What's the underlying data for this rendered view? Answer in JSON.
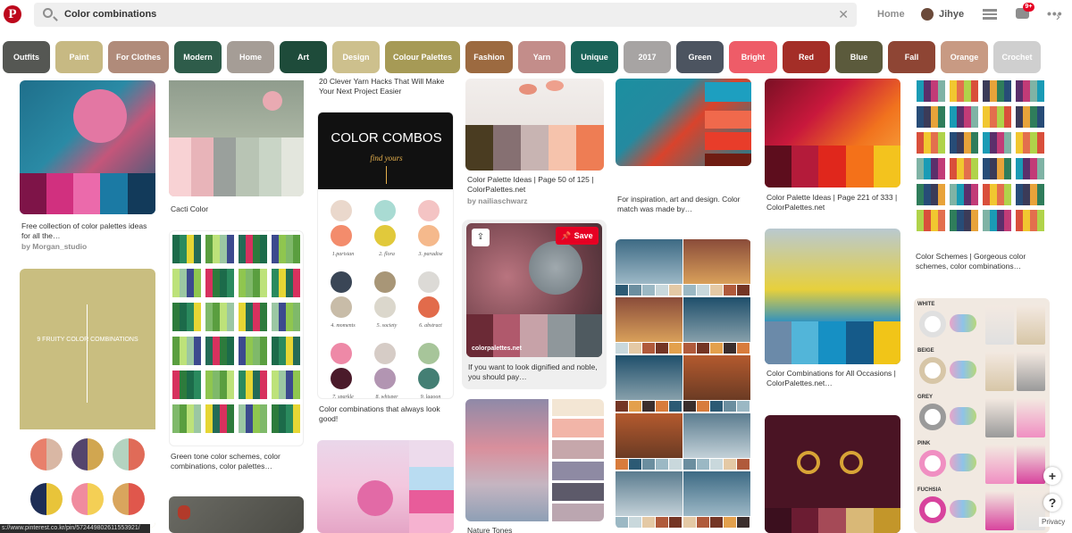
{
  "app": {
    "logo": "P",
    "search_query": "Color combinations",
    "nav_home": "Home",
    "user_name": "Jihye",
    "notif_count": "9+",
    "url_status": "s://www.pinterest.co.kr/pin/572449802611553921/",
    "privacy": "Privacy"
  },
  "chips": [
    {
      "label": "Outfits",
      "color": "#555753"
    },
    {
      "label": "Paint",
      "color": "#c7b983"
    },
    {
      "label": "For Clothes",
      "color": "#b08b7a"
    },
    {
      "label": "Modern",
      "color": "#2e5c4a"
    },
    {
      "label": "Home",
      "color": "#a59d96"
    },
    {
      "label": "Art",
      "color": "#1e4b3a"
    },
    {
      "label": "Design",
      "color": "#cdc08d"
    },
    {
      "label": "Colour Palettes",
      "color": "#a69a56"
    },
    {
      "label": "Fashion",
      "color": "#9c6a40"
    },
    {
      "label": "Yarn",
      "color": "#c38d8a"
    },
    {
      "label": "Unique",
      "color": "#1a6358"
    },
    {
      "label": "2017",
      "color": "#a7a4a3"
    },
    {
      "label": "Green",
      "color": "#4c5460"
    },
    {
      "label": "Bright",
      "color": "#ee5c68"
    },
    {
      "label": "Red",
      "color": "#a42e27"
    },
    {
      "label": "Blue",
      "color": "#5b5a3c"
    },
    {
      "label": "Fall",
      "color": "#8e4534"
    },
    {
      "label": "Orange",
      "color": "#c89a83"
    },
    {
      "label": "Crochet",
      "color": "#cfcfcf"
    }
  ],
  "pins": {
    "p1_title": "Free collection of color palettes ideas for all the…",
    "p1_by": "by Morgan_studio",
    "p2_title": "Cacti Color",
    "p3_top": "20 Clever Yarn Hacks That Will Make Your Next Project Easier",
    "p3_head": "COLOR COMBOS",
    "p3_script": "find yours",
    "p3_labels": [
      "1.parisian",
      "2. flora",
      "3. paradise",
      "4. moments",
      "5. society",
      "6. abstract",
      "7. sparkle",
      "8. whisper",
      "9. lagoon"
    ],
    "p3_title": "Color combinations that always look good!",
    "p4_title": "Color Palette Ideas | Page 50 of 125 | ColorPalettes.net",
    "p4_by": "by nailiaschwarz",
    "p5_save": "Save",
    "p5_brand": "colorpalettes.net",
    "p5_title": "If you want to look dignified and noble, you should pay…",
    "p6_title": "For inspiration, art and design. Color match was made by…",
    "p7_title": "Color Palette Ideas | Page 221 of 333 | ColorPalettes.net",
    "p8_title": "Color Schemes | Gorgeous color schemes, color combinations…",
    "p9_title": "Green tone color schemes, color combinations, color palettes…",
    "p10_title": "Color Combinations for All Occasions | ColorPalettes.net…",
    "p11_title": "Nature Tones",
    "p12_head": "9 FRUITY COLOR COMBINATIONS",
    "p13_rows": [
      "WHITE",
      "BEIGE",
      "GREY",
      "PINK",
      "FUCHSIA"
    ]
  },
  "colors": {
    "brand": "#e60023"
  }
}
